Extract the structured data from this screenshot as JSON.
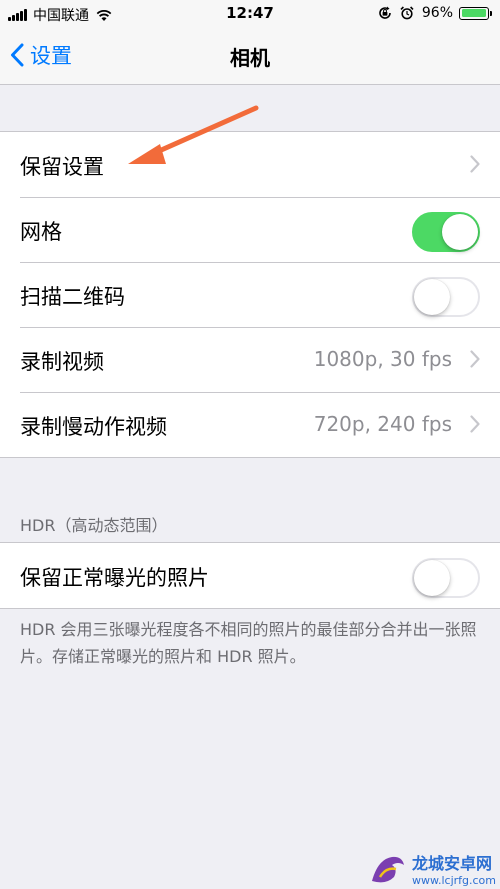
{
  "status_bar": {
    "carrier": "中国联通",
    "time": "12:47",
    "battery": "96%",
    "battery_level": 0.96,
    "icons": [
      "signal-icon",
      "wifi-icon",
      "rotation-lock-icon",
      "alarm-icon",
      "battery-icon"
    ]
  },
  "nav": {
    "back_label": "设置",
    "title": "相机"
  },
  "main_group": [
    {
      "label": "保留设置",
      "type": "chevron"
    },
    {
      "label": "网格",
      "type": "toggle",
      "on": true
    },
    {
      "label": "扫描二维码",
      "type": "toggle",
      "on": false
    },
    {
      "label": "录制视频",
      "type": "chevron",
      "value": "1080p, 30 fps"
    },
    {
      "label": "录制慢动作视频",
      "type": "chevron",
      "value": "720p, 240 fps"
    }
  ],
  "hdr": {
    "section_header": "HDR（高动态范围）",
    "row_label": "保留正常曝光的照片",
    "row_on": false,
    "footer": "HDR 会用三张曝光程度各不相同的照片的最佳部分合并出一张照片。存储正常曝光的照片和 HDR 照片。"
  },
  "annotation": {
    "arrow_color": "#f26b3a"
  },
  "watermark": {
    "name": "龙城安卓网",
    "url": "www.lcjrfg.com"
  },
  "colors": {
    "accent": "#007aff",
    "toggle_on": "#4cd964",
    "background": "#efeff4"
  }
}
